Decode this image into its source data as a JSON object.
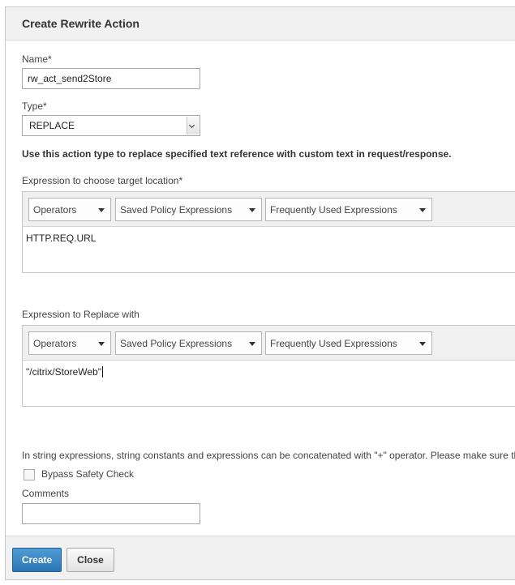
{
  "dialog": {
    "title": "Create Rewrite Action"
  },
  "name_field": {
    "label": "Name*",
    "value": "rw_act_send2Store"
  },
  "type_field": {
    "label": "Type*",
    "value": "REPLACE"
  },
  "description": "Use this action type to replace specified text reference with custom text in request/response.",
  "target_expression": {
    "label": "Expression to choose target location*",
    "toolbar": {
      "operators": "Operators",
      "saved": "Saved Policy Expressions",
      "frequent": "Frequently Used Expressions"
    },
    "value": "HTTP.REQ.URL"
  },
  "replace_expression": {
    "label": "Expression to Replace with",
    "toolbar": {
      "operators": "Operators",
      "saved": "Saved Policy Expressions",
      "frequent": "Frequently Used Expressions"
    },
    "value": "\"/citrix/StoreWeb\""
  },
  "note": "In string expressions, string constants and expressions can be concatenated with \"+\" operator. Please make sure that",
  "bypass_safety": {
    "label": "Bypass Safety Check",
    "checked": false
  },
  "comments": {
    "label": "Comments",
    "value": ""
  },
  "buttons": {
    "create": "Create",
    "close": "Close"
  },
  "colors": {
    "primary_button": "#2b77b6",
    "header_bg": "#f1f1f1"
  },
  "icons": {
    "select_arrow": "chevron-down-icon",
    "dropdown_arrow": "caret-down-icon"
  }
}
